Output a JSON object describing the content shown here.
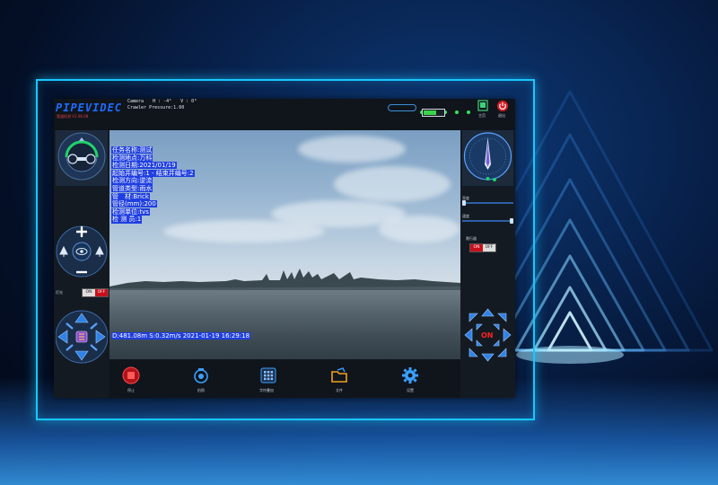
{
  "app": {
    "logo_text": "PIPEVIDEC",
    "logo_sub": "管道检测 V1.06.08",
    "camera": {
      "label": "Camera",
      "h": "H : -4°",
      "v": "V : 0°",
      "pressure": "Crawler Pressure:1.60"
    },
    "top_buttons": [
      {
        "label": "主页",
        "icon": "home-icon"
      },
      {
        "label": "退出",
        "icon": "power-icon"
      }
    ]
  },
  "overlay": {
    "lines": [
      "任务名称:测试",
      "检测地点:万科",
      "检测日期:2021/01/19",
      "起始井编号:1 - 结束井编号:2",
      "检测方向:逆流",
      "管道类型:雨水",
      "管　材:Brick",
      "管径(mm):200",
      "检测单位:tvs",
      "检 测 员:1"
    ],
    "status": "D:481.08m S:0.32m/s  2021-01-19 16:29:18"
  },
  "left_panel": {
    "light_toggle_label": "灯光",
    "toggle_on": "ON",
    "toggle_off": "OFF"
  },
  "right_panel": {
    "slider_a_label": "亮度",
    "slider_b_label": "速度",
    "toggle_label": "爬行器",
    "toggle_on": "ON",
    "toggle_off": "OFF",
    "center_label": "ON"
  },
  "bottom_bar": [
    {
      "label": "停止",
      "icon": "stop-icon",
      "color": "#e02020"
    },
    {
      "label": "拍照",
      "icon": "camera-icon",
      "color": "#3aa0ff"
    },
    {
      "label": "字符叠加",
      "icon": "keypad-icon",
      "color": "#3aa0ff"
    },
    {
      "label": "文件",
      "icon": "folder-icon",
      "color": "#f0a020"
    },
    {
      "label": "设置",
      "icon": "settings-icon",
      "color": "#3aa0ff"
    }
  ],
  "colors": {
    "accent": "#19c6ff",
    "overlay_bg": "#1f3fe0",
    "stop": "#e02020",
    "off": "#c7101c"
  }
}
